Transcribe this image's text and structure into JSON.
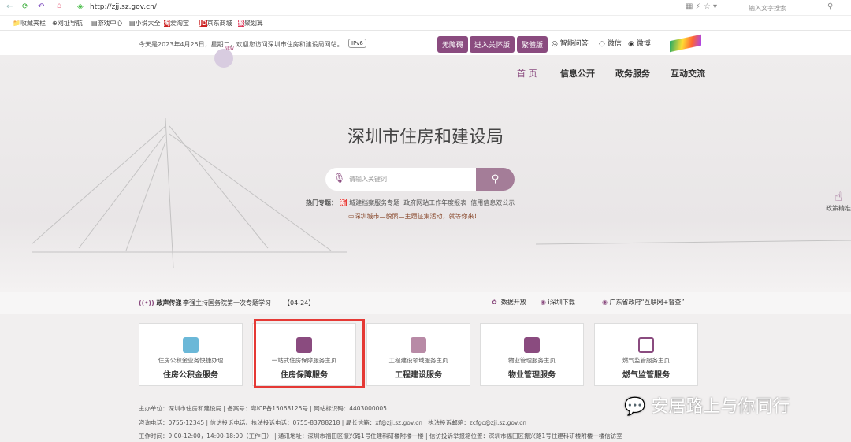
{
  "browser": {
    "url": "http://zjj.sz.gov.cn/",
    "search_placeholder": "输入文字搜索",
    "bookmarks": [
      "收藏夹栏",
      "网址导航",
      "游戏中心",
      "小说大全",
      "爱淘宝",
      "京东商城",
      "聚划算"
    ]
  },
  "header": {
    "date_text": "今天是2023年4月25日，星期二，欢迎您访问深圳市住房和建设局网站。",
    "ipv6": "IPv6",
    "new_badge": "NEW",
    "buttons": [
      "无障碍",
      "进入关怀版",
      "繁體版"
    ],
    "links": [
      "智能问答",
      "微信",
      "微博"
    ]
  },
  "nav": [
    "首 页",
    "信息公开",
    "政务服务",
    "互动交流"
  ],
  "hero": {
    "title": "深圳市住房和建设局",
    "search_placeholder": "请输入关键词",
    "hot_label": "热门专题：",
    "new_tag": "新",
    "hot_topics": [
      "城建档案服务专题",
      "政府网站工作年度报表",
      "信用信息双公示"
    ],
    "activity": "深圳城市二貌照二主题征集活动，就等你来！",
    "side_label": "政策精准"
  },
  "news": {
    "label": "政声传递",
    "headline": "李强主持国务院第一次专题学习",
    "date": "【04-24】",
    "links": [
      "数据开放",
      "i深圳下载",
      "广东省政府“互联网+督查”"
    ]
  },
  "cards": [
    {
      "sub": "住房公积金业务快捷办理",
      "title": "住房公积金服务"
    },
    {
      "sub": "一站式住房保障服务主页",
      "title": "住房保障服务"
    },
    {
      "sub": "工程建设领域服务主页",
      "title": "工程建设服务"
    },
    {
      "sub": "物业管理服务主页",
      "title": "物业管理服务"
    },
    {
      "sub": "燃气监管服务主页",
      "title": "燃气监管服务"
    }
  ],
  "footer": [
    "主办单位：深圳市住房和建设局  |  备案号：粤ICP备15068125号  |  网站标识码：4403000005",
    "咨询电话：0755-12345  |  信访投诉电话、执法投诉电话：0755-83788218  |  局长信箱：xf@zjj.sz.gov.cn  |  执法投诉邮箱：zcfgc@zjj.sz.gov.cn",
    "工作时间：9:00-12:00，14:00-18:00（工作日）  |  通讯地址：深圳市福田区振兴路1号住建科研楼附楼一楼  |  信访投诉举报箱位置：深圳市福田区振兴路1号住建科研楼附楼一楼信访室"
  ],
  "watermark": "安居路上与你同行",
  "colors": {
    "accent": "#8a4b7f",
    "highlight": "#e53935"
  }
}
